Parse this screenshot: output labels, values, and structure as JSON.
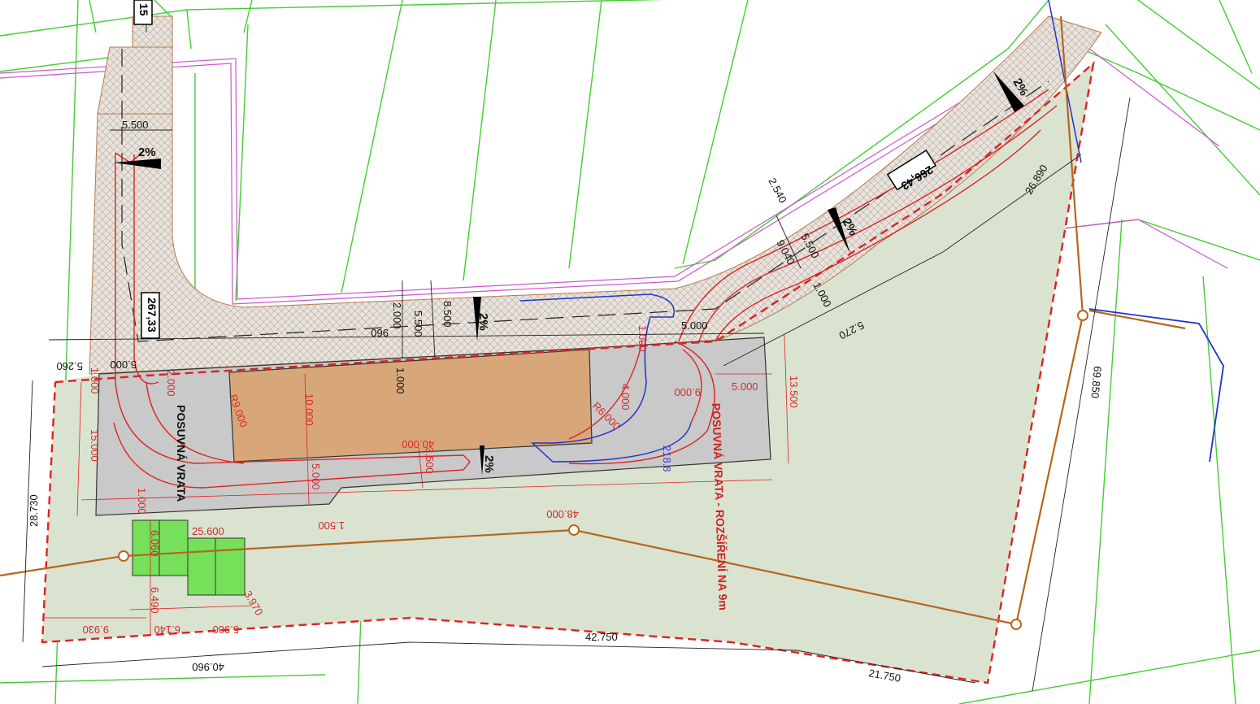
{
  "colors": {
    "plot_fill": "#d9e3d0",
    "road_hatch": "#e6dcd2",
    "paved_area": "#c8c8c8",
    "building": "#d7a77a",
    "parking": "#76e05a",
    "parcel_line": "#44cc33",
    "boundary_dashed": "#dd2222",
    "turning_path": "#dd2222",
    "turning_path_alt": "#2233cc",
    "utility_line": "#b8651b",
    "magenta_line": "#cc55cc"
  },
  "icons": {
    "slope_marker": "black-triangle-arrow",
    "utility_node": "circle-node"
  },
  "labels": {
    "level_left": "267,33",
    "level_right": "266,43",
    "level_top_partial": "15",
    "gate_left": "POSUVNÁ VRATA",
    "gate_right": "POSUVNÁ VRATA - ROZŠÍŘENÍ NA 9m",
    "slope_1": "2%",
    "slope_2": "2%",
    "slope_3": "2%",
    "slope_4": "2%",
    "slope_5": "2%"
  },
  "dimensions": {
    "d_5500_top": "5.500",
    "d_2540": "2.540",
    "d_26890": "26.890",
    "d_9040": "9.040",
    "d_5500_right": "5.500",
    "d_1000_right": "1.000",
    "d_2000": "2.000",
    "d_5500_mid": "5.500",
    "d_8500": "8.500",
    "d_960": "960",
    "d_5000_gate": "5.000",
    "d_5270": "5.270",
    "d_5260": "5.260",
    "d_5000_left": "5.000",
    "d_1000_left": "1.000",
    "d_1000_center": "1.000",
    "d_2000_left": "2.000",
    "d_15000": "15.000",
    "d_r9": "R9.000",
    "d_10000": "10.000",
    "d_40000": "40.000",
    "d_3500": "3.500",
    "d_5000_bottom": "5.000",
    "d_1000_lower": "1.000",
    "d_4000": "4.000",
    "d_r6": "R6.000",
    "d_9000": "9.000",
    "d_5000_east": "5.000",
    "d_13500": "13.500",
    "d_218": "218.8",
    "d_1500": "1.500",
    "d_48000": "48.000",
    "d_28730": "28.730",
    "d_25600": "25.600",
    "d_6060": "6.060",
    "d_69850": "69.850",
    "d_6490": "6.490",
    "d_3970": "3.970",
    "d_9930": "9.930",
    "d_6140": "6.140",
    "d_5980": "5.980",
    "d_42750": "42.750",
    "d_40960": "40.960",
    "d_21750": "21.750",
    "d_1000_gate": "1.000"
  }
}
